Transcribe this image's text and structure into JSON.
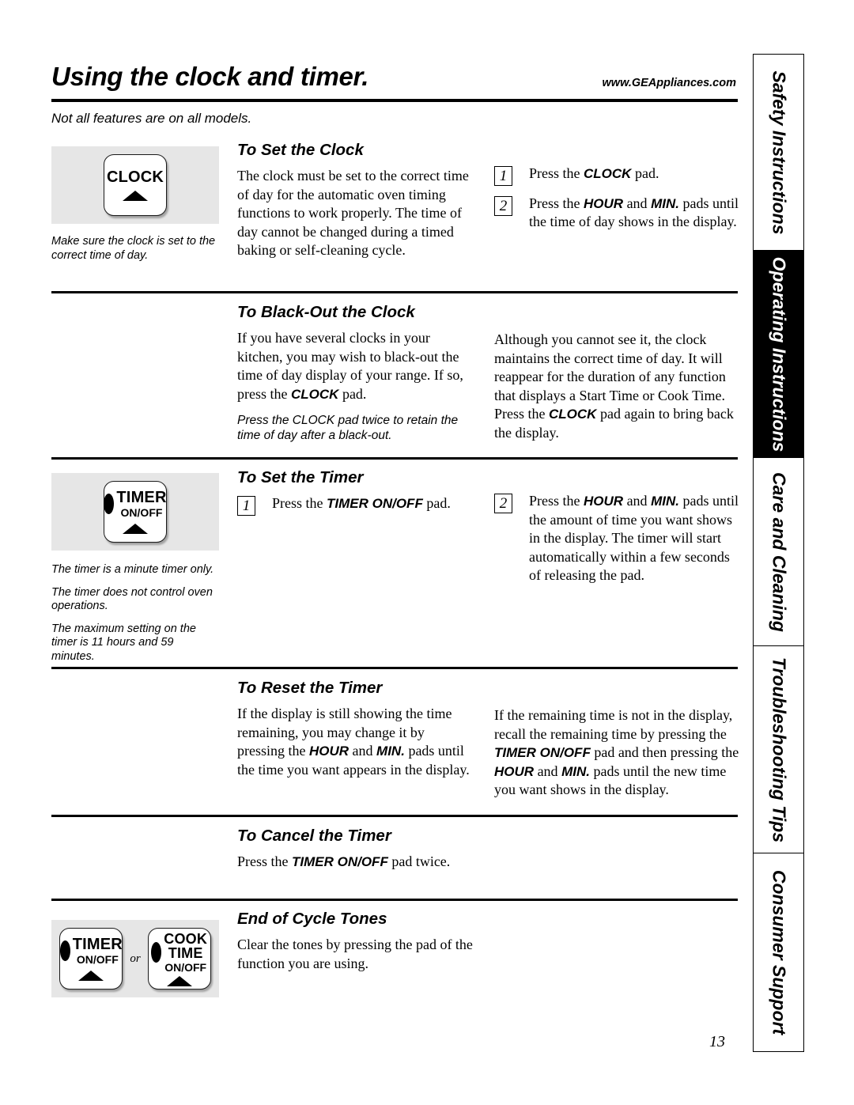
{
  "header": {
    "title": "Using the clock and timer.",
    "url": "www.GEAppliances.com",
    "subtitle": "Not all features are on all models."
  },
  "page_number": "13",
  "tabs": [
    {
      "label": "Safety Instructions",
      "active": false
    },
    {
      "label": "Operating Instructions",
      "active": true
    },
    {
      "label": "Care and Cleaning",
      "active": false
    },
    {
      "label": "Troubleshooting Tips",
      "active": false
    },
    {
      "label": "Consumer Support",
      "active": false
    }
  ],
  "sections": {
    "set_clock": {
      "heading": "To Set the Clock",
      "body": "The clock must be set to the correct time of day for the automatic oven timing functions to work properly. The time of day cannot be changed during a timed baking or self-cleaning cycle.",
      "steps": [
        {
          "number": "1",
          "text_1": "Press the ",
          "pad_1": "CLOCK",
          "text_2": " pad."
        },
        {
          "number": "2",
          "text_1": "Press the ",
          "pad_1": "HOUR",
          "text_2": " and ",
          "pad_2": "MIN.",
          "text_3": " pads until the time of day shows in the display."
        }
      ],
      "pad": {
        "main": "CLOCK",
        "sub": "",
        "oval": false
      },
      "note": "Make sure the clock is set to the correct time of day."
    },
    "black_out_clock": {
      "heading": "To Black-Out the Clock",
      "left_text_1": "If you have several clocks in your kitchen, you may wish to black-out the time of day display of your range. If so, press the ",
      "left_pad": "CLOCK",
      "left_text_2": " pad.",
      "left_note": "Press the CLOCK pad twice to retain the time of day after a black-out.",
      "right_text_1": "Although you cannot see it, the clock maintains the correct time of day. It will reappear for the duration of any function that displays a Start Time or Cook Time. Press the ",
      "right_pad": "CLOCK",
      "right_text_2": " pad again to bring back the display."
    },
    "set_timer": {
      "heading": "To Set the Timer",
      "steps": [
        {
          "number": "1",
          "text_1": "Press the ",
          "pad_1": "TIMER ON/OFF",
          "text_2": " pad."
        },
        {
          "number": "2",
          "text_1": "Press the ",
          "pad_1": "HOUR",
          "text_2": " and ",
          "pad_2": "MIN.",
          "text_3": " pads until the amount of time you want shows in the display. The timer will start automatically within a few seconds of releasing the pad."
        }
      ],
      "pad": {
        "main": "TIMER",
        "sub": "ON/OFF",
        "oval": true
      },
      "notes": [
        "The timer is a minute timer only.",
        "The timer does not control oven operations.",
        "The maximum setting on the timer is 11 hours and 59 minutes."
      ]
    },
    "reset_timer": {
      "heading": "To Reset the Timer",
      "left_text_1": "If the display is still showing the time remaining, you may change it by pressing the ",
      "left_pad_1": "HOUR",
      "left_text_2": " and ",
      "left_pad_2": "MIN.",
      "left_text_3": " pads until the time you want appears in the display.",
      "right_text_1": "If the remaining time is not in the display, recall the remaining time by pressing the ",
      "right_pad_1": "TIMER ON/OFF",
      "right_text_2": " pad and then pressing the ",
      "right_pad_2": "HOUR",
      "right_text_3": " and ",
      "right_pad_3": "MIN.",
      "right_text_4": " pads until the new time you want shows in the display."
    },
    "cancel_timer": {
      "heading": "To Cancel the Timer",
      "text_1": "Press the ",
      "pad_1": "TIMER ON/OFF",
      "text_2": " pad twice."
    },
    "end_of_cycle": {
      "heading": "End of Cycle Tones",
      "body": "Clear the tones by pressing the pad of the function you are using.",
      "pads": {
        "first": {
          "main": "TIMER",
          "sub": "ON/OFF",
          "oval": true
        },
        "separator": "or",
        "second": {
          "main_line1": "COOK",
          "main_line2": "TIME",
          "sub": "ON/OFF",
          "oval": true
        }
      }
    }
  }
}
